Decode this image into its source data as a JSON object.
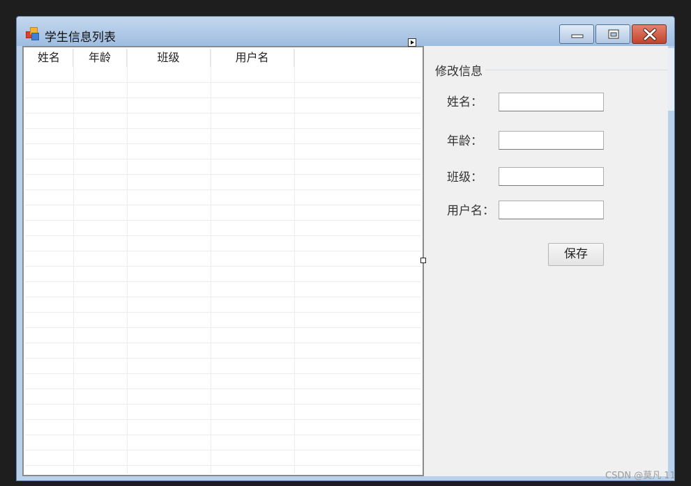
{
  "window": {
    "title": "学生信息列表",
    "buttons": {
      "minimize": "minimize-icon",
      "maximize": "maximize-icon",
      "close": "close-icon"
    }
  },
  "grid": {
    "columns": [
      "姓名",
      "年龄",
      "班级",
      "用户名"
    ],
    "rows": []
  },
  "edit_group": {
    "title": "修改信息",
    "fields": [
      {
        "label": "姓名：",
        "value": ""
      },
      {
        "label": "年龄：",
        "value": ""
      },
      {
        "label": "班级：",
        "value": ""
      },
      {
        "label": "用户名：",
        "value": ""
      }
    ],
    "save_label": "保存"
  },
  "watermark": "CSDN @莫凡 11",
  "colors": {
    "title_bar": "#9fbde0",
    "close_button": "#c2442d",
    "form_bg": "#f0f0f0"
  }
}
